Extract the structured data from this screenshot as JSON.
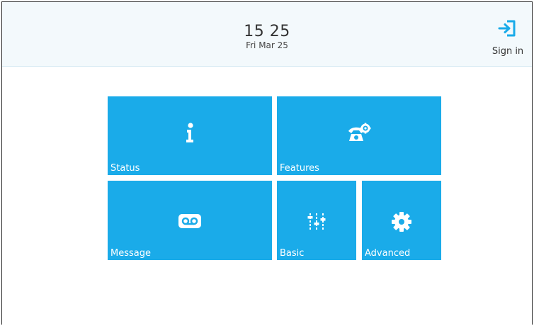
{
  "header": {
    "time": "15 25",
    "date": "Fri Mar 25",
    "sign_in_label": "Sign in"
  },
  "tiles": [
    {
      "id": "status",
      "label": "Status",
      "icon": "info-icon"
    },
    {
      "id": "features",
      "label": "Features",
      "icon": "phone-settings-icon"
    },
    {
      "id": "message",
      "label": "Message",
      "icon": "voicemail-icon"
    },
    {
      "id": "basic",
      "label": "Basic",
      "icon": "sliders-icon"
    },
    {
      "id": "advanced",
      "label": "Advanced",
      "icon": "gear-icon"
    }
  ],
  "colors": {
    "tile": "#1aabe9",
    "header_bg": "#f3f9fc",
    "signin_icon": "#1aabe9"
  }
}
